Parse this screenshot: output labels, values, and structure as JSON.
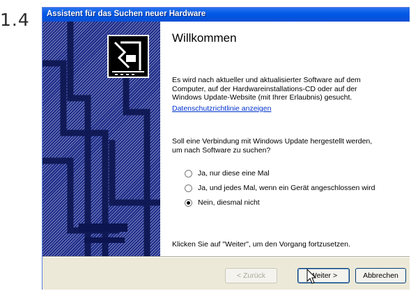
{
  "step_label": "1.4",
  "window": {
    "title": "Assistent für das Suchen neuer Hardware"
  },
  "content": {
    "heading": "Willkommen",
    "intro_lines": [
      "Es wird nach aktueller und aktualisierter Software auf dem",
      "Computer, auf der Hardwareinstallations-CD oder auf der",
      "Windows Update-Website (mit Ihrer Erlaubnis) gesucht."
    ],
    "privacy_link": "Datenschutzrichtlinie anzeigen",
    "question_lines": [
      "Soll eine Verbindung mit Windows Update hergestellt werden,",
      "um nach Software zu suchen?"
    ],
    "options": [
      {
        "label": "Ja, nur diese eine Mal",
        "checked": false
      },
      {
        "label": "Ja, und jedes Mal, wenn ein Gerät angeschlossen wird",
        "checked": false
      },
      {
        "label": "Nein, diesmal nicht",
        "checked": true
      }
    ],
    "footer": "Klicken Sie auf \"Weiter\", um den Vorgang fortzusetzen."
  },
  "buttons": {
    "back": "< Zurück",
    "next": "Weiter >",
    "cancel": "Abbrechen"
  },
  "icons": {
    "wizard": "hardware-card-icon",
    "cursor": "mouse-pointer-icon"
  },
  "colors": {
    "title_bar": "#0058e6",
    "panel": "#1b2a88",
    "link": "#0033cc",
    "dialog_bg": "#ece9d8"
  }
}
